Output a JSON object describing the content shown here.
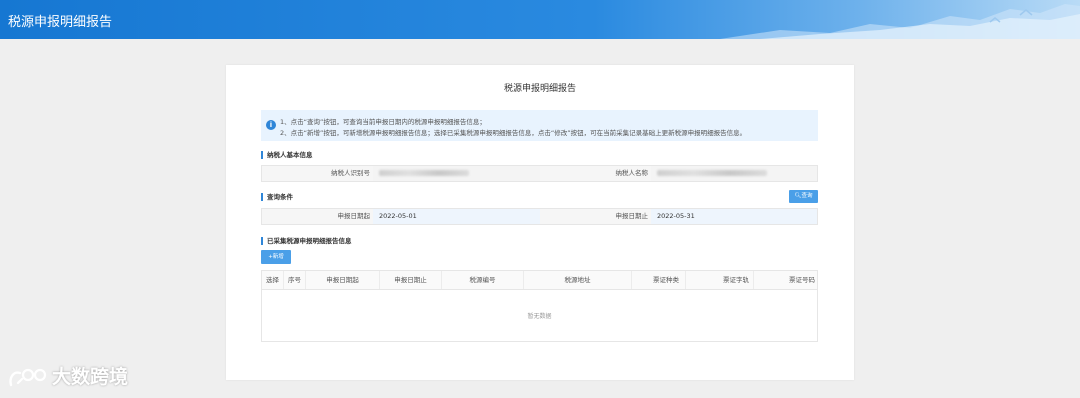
{
  "header": {
    "title": "税源申报明细报告"
  },
  "card": {
    "title": "税源申报明细报告",
    "notice": {
      "line1": "1、点击“查询”按钮，可查询当前申报日期内的税源申报明细报告信息；",
      "line2": "2、点击“新增”按钮，可新增税源申报明细报告信息；选择已采集税源申报明细报告信息，点击“修改”按钮，可在当前采集记录基础上更新税源申报明细报告信息。"
    },
    "taxpayer": {
      "section_title": "纳税人基本信息",
      "id_label": "纳税人识别号",
      "name_label": "纳税人名称"
    },
    "query": {
      "section_title": "查询条件",
      "button_label": "查询",
      "start_label": "申报日期起",
      "start_value": "2022-05-01",
      "end_label": "申报日期止",
      "end_value": "2022-05-31"
    },
    "records": {
      "section_title": "已采集税源申报明细报告信息",
      "add_button_label": "新增",
      "columns": [
        "选择",
        "序号",
        "申报日期起",
        "申报日期止",
        "税源编号",
        "税源地址",
        "票证种类",
        "票证字轨",
        "票证号码"
      ],
      "empty_text": "暂无数据"
    }
  },
  "watermark": {
    "text": "大数跨境"
  },
  "colors": {
    "primary": "#2f86d8",
    "button": "#4a9fe8",
    "header_start": "#1677d2"
  }
}
